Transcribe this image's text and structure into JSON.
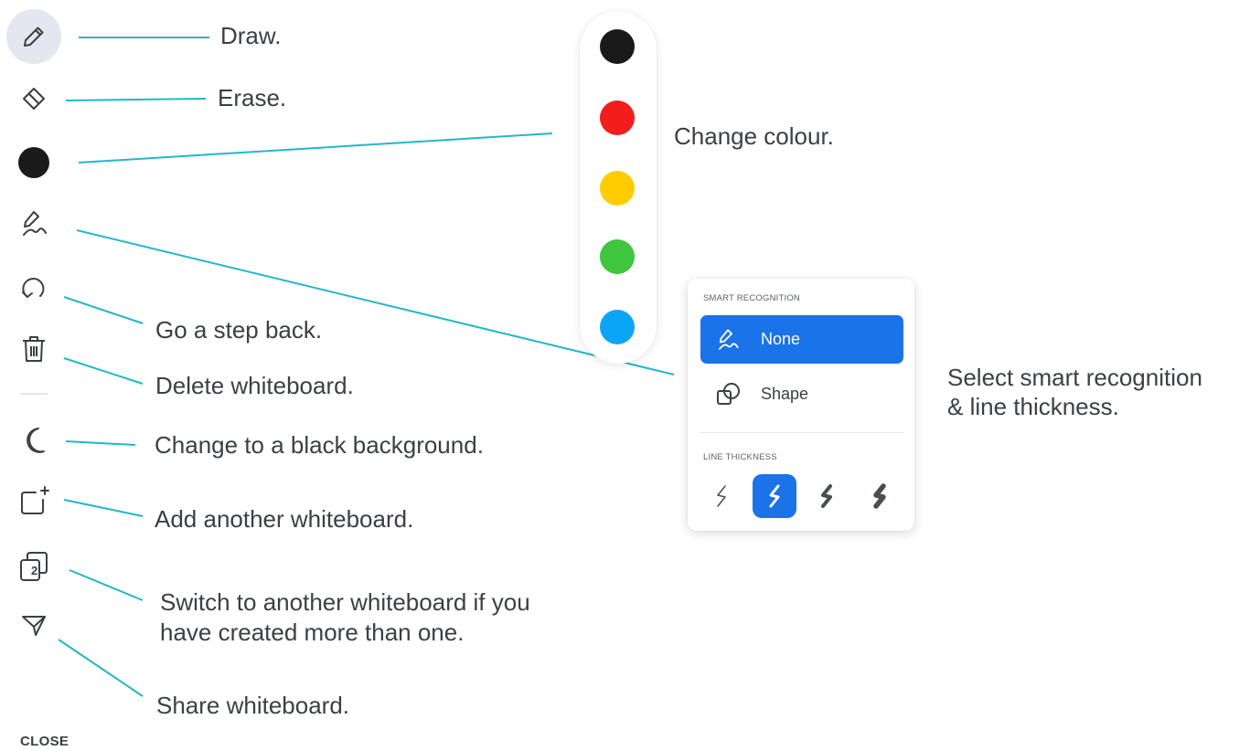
{
  "toolbar": {
    "tools": [
      {
        "name": "pencil-icon",
        "label": "Draw.",
        "active": true
      },
      {
        "name": "eraser-icon",
        "label": "Erase."
      },
      {
        "name": "color-dot-icon",
        "label": "Change colour.",
        "color": "#1a1a1a"
      },
      {
        "name": "pen-scribble-icon",
        "label": "Select smart recognition & line thickness."
      },
      {
        "name": "undo-icon",
        "label": "Go a step back."
      },
      {
        "name": "trash-icon",
        "label": "Delete whiteboard."
      },
      {
        "name": "moon-icon",
        "label": "Change to a black background."
      },
      {
        "name": "add-board-icon",
        "label": "Add another whiteboard."
      },
      {
        "name": "switch-board-icon",
        "label": "Switch to another whiteboard if you have created more than one.",
        "badge": "2"
      },
      {
        "name": "share-icon",
        "label": "Share whiteboard."
      }
    ],
    "close_label": "CLOSE"
  },
  "callouts": {
    "draw": "Draw.",
    "erase": "Erase.",
    "colour": "Change colour.",
    "smart_line1": "Select smart recognition",
    "smart_line2": "& line thickness.",
    "step_back": "Go a step back.",
    "delete": "Delete whiteboard.",
    "black_bg": "Change to a black background.",
    "add": "Add another whiteboard.",
    "switch_line1": "Switch to another whiteboard if you",
    "switch_line2": "have created more than one.",
    "share": "Share whiteboard."
  },
  "palette": {
    "colors": [
      "#1a1a1a",
      "#f21d1d",
      "#ffcc00",
      "#3ec63e",
      "#0aa6f5"
    ]
  },
  "smart_recognition": {
    "title": "SMART RECOGNITION",
    "options": [
      {
        "label": "None",
        "icon": "pen-scribble-icon",
        "selected": true
      },
      {
        "label": "Shape",
        "icon": "shapes-icon",
        "selected": false
      }
    ],
    "thickness_title": "LINE THICKNESS",
    "thickness_levels": [
      {
        "level": 1,
        "selected": false
      },
      {
        "level": 2,
        "selected": true
      },
      {
        "level": 3,
        "selected": false
      },
      {
        "level": 4,
        "selected": false
      }
    ]
  },
  "colors": {
    "accent": "#1a73e8",
    "leader_line": "#21b8c8",
    "text": "#3c3f44"
  }
}
